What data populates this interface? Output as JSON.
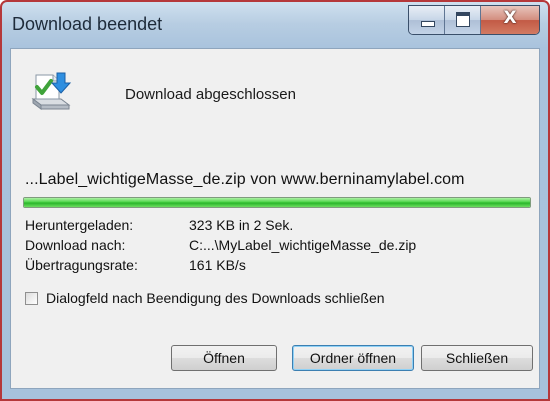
{
  "window": {
    "title": "Download beendet",
    "controls": {
      "minimize_icon": "minimize-icon",
      "maximize_icon": "maximize-icon",
      "close_icon": "close-icon",
      "close_glyph": "X"
    }
  },
  "header": {
    "icon": "download-complete-icon",
    "text": "Download abgeschlossen"
  },
  "file": {
    "line": "...Label_wichtigeMasse_de.zip von www.berninamylabel.com",
    "progress_fraction": 1.0
  },
  "info": [
    {
      "label": "Heruntergeladen:",
      "value": "323 KB in 2 Sek."
    },
    {
      "label": "Download nach:",
      "value": "C:...\\MyLabel_wichtigeMasse_de.zip"
    },
    {
      "label": "Übertragungsrate:",
      "value": "161 KB/s"
    }
  ],
  "checkbox": {
    "label": "Dialogfeld nach Beendigung des Downloads schließen",
    "checked": false
  },
  "buttons": {
    "open": "Öffnen",
    "open_folder": "Ordner öffnen",
    "close": "Schließen"
  },
  "colors": {
    "progress": "#2db42c",
    "title_border": "#b5383a"
  }
}
